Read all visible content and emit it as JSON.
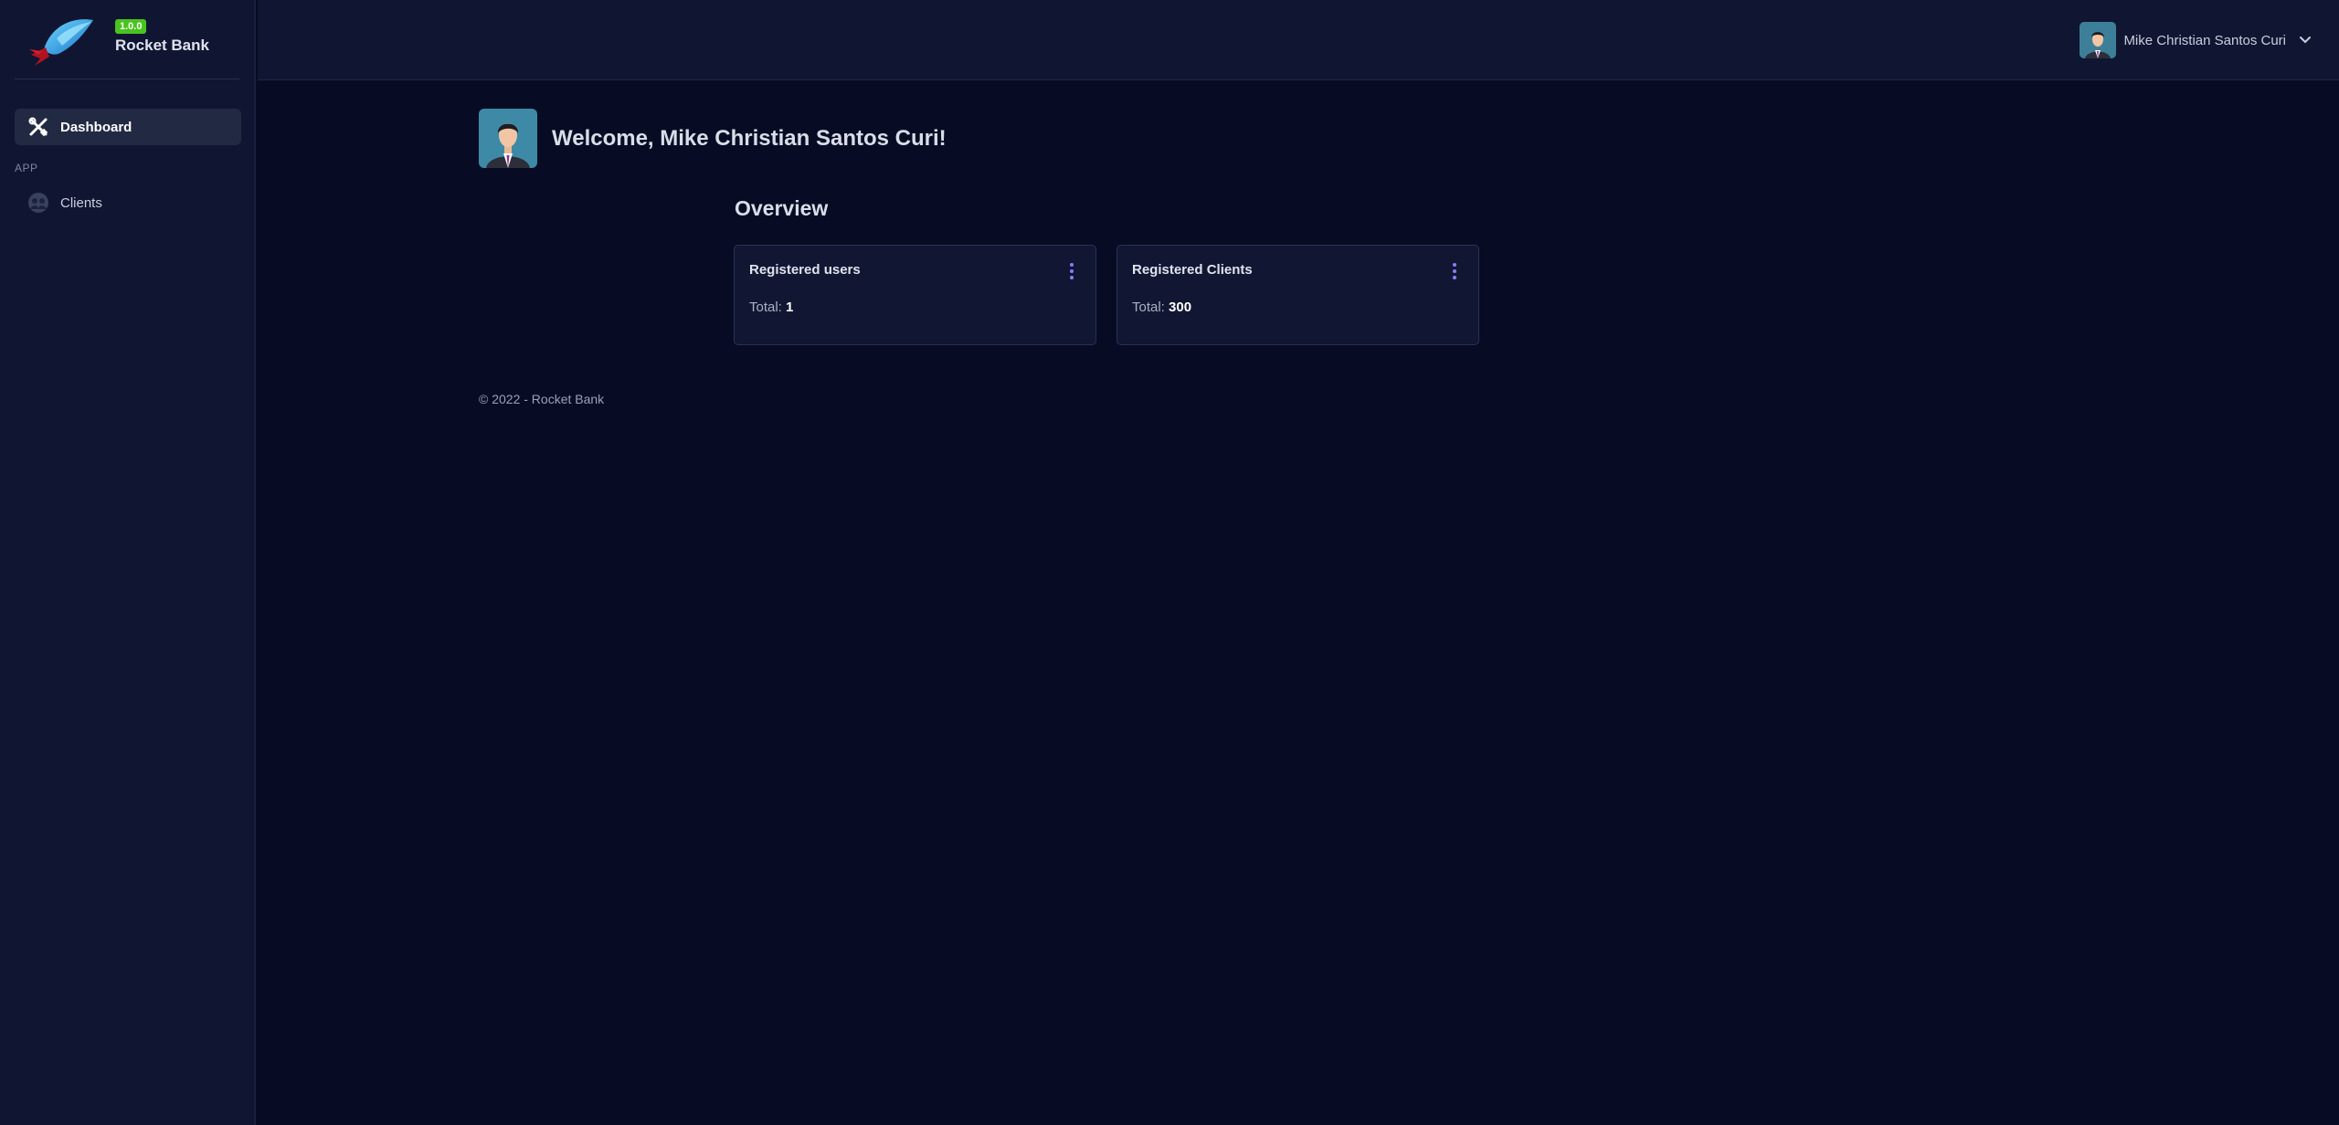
{
  "brand": {
    "version": "1.0.0",
    "name": "Rocket Bank"
  },
  "sidebar": {
    "items": [
      {
        "label": "Dashboard",
        "icon": "tools-icon",
        "active": true
      },
      {
        "label": "Clients",
        "icon": "users-icon",
        "active": false
      }
    ],
    "section_label": "APP"
  },
  "header": {
    "user_name": "Mike Christian Santos Curi"
  },
  "main": {
    "welcome": "Welcome, Mike Christian Santos Curi!",
    "overview_title": "Overview",
    "cards": [
      {
        "title": "Registered users",
        "total_label": "Total:",
        "total_value": "1"
      },
      {
        "title": "Registered Clients",
        "total_label": "Total:",
        "total_value": "300"
      }
    ]
  },
  "footer": {
    "text": "© 2022 - Rocket Bank"
  },
  "colors": {
    "background": "#070c24",
    "panel": "#101632",
    "accent": "#8b7cf6",
    "badge": "#49c41f"
  }
}
